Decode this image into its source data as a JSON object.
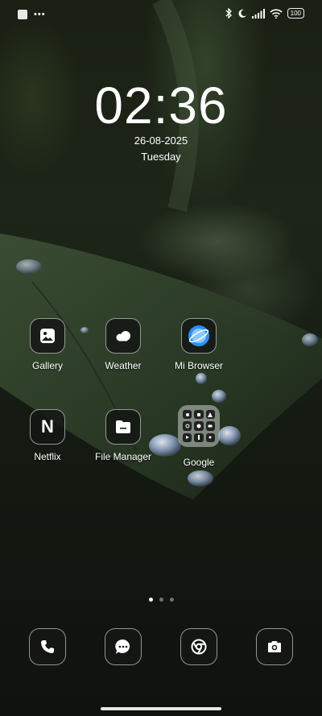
{
  "status_bar": {
    "battery": "100",
    "icons": [
      "bluetooth-icon",
      "moon-icon",
      "signal-icon",
      "wifi-icon"
    ]
  },
  "lockscreen": {
    "time": "02:36",
    "date": "26-08-2025",
    "weekday": "Tuesday"
  },
  "apps": [
    {
      "label": "Gallery",
      "icon": "gallery-icon"
    },
    {
      "label": "Weather",
      "icon": "weather-icon"
    },
    {
      "label": "Mi Browser",
      "icon": "browser-icon"
    },
    {
      "label": "Netflix",
      "icon": "netflix-icon",
      "glyph": "N"
    },
    {
      "label": "File Manager",
      "icon": "folder-icon"
    },
    {
      "label": "Google",
      "icon": "app-folder-icon"
    }
  ],
  "dock": [
    {
      "icon": "phone-icon"
    },
    {
      "icon": "messages-icon"
    },
    {
      "icon": "chrome-icon"
    },
    {
      "icon": "camera-icon"
    }
  ],
  "pager": {
    "pages": 3,
    "current": 1
  },
  "colors": {
    "browser_blue": "#2f8ff5",
    "icon_border": "#cfcfcf"
  }
}
